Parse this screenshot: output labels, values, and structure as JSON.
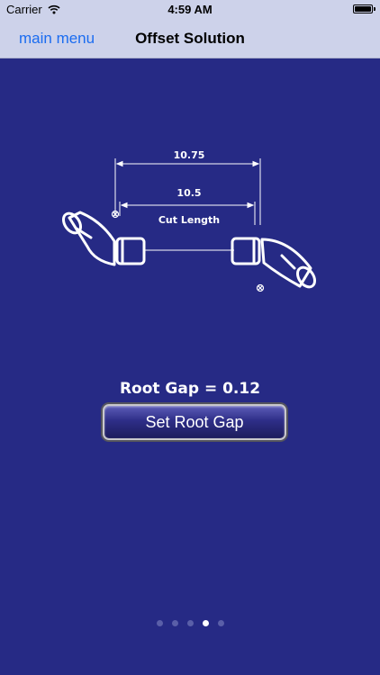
{
  "status_bar": {
    "carrier": "Carrier",
    "time": "4:59 AM"
  },
  "nav": {
    "back_label": "main menu",
    "title": "Offset Solution"
  },
  "diagram": {
    "overall_dimension": "10.75",
    "inner_dimension": "10.5",
    "cut_length_label": "Cut Length"
  },
  "root_gap": {
    "label": "Root Gap = 0.12",
    "button_label": "Set Root Gap"
  },
  "pagination": {
    "page_count": 5,
    "current_page": 4
  },
  "colors": {
    "background": "#262a85",
    "nav_background": "#cdd2ea",
    "link": "#1b6cf0"
  }
}
